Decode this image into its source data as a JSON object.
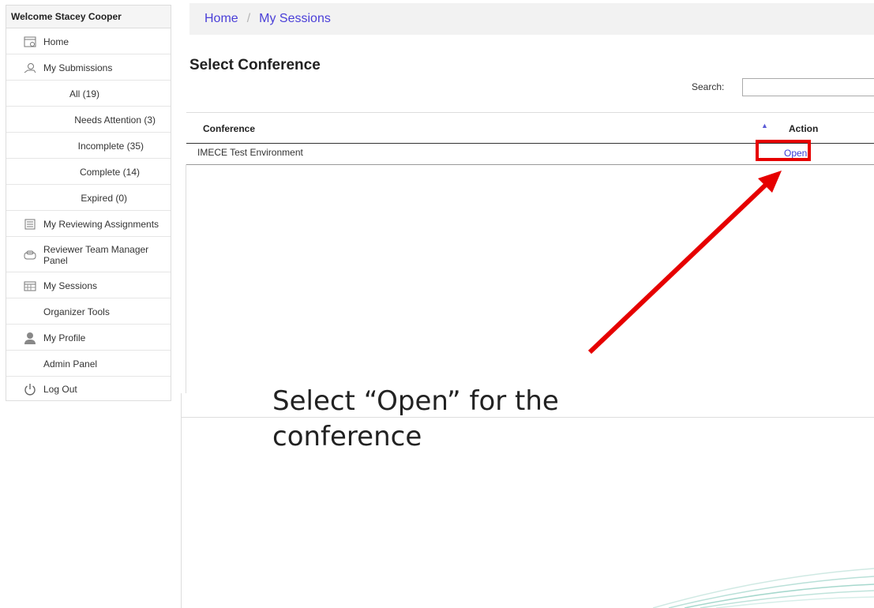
{
  "sidebar": {
    "welcome": "Welcome Stacey Cooper",
    "items": [
      {
        "label": "Home",
        "icon": "home-icon"
      },
      {
        "label": "My Submissions",
        "icon": "submissions-icon"
      },
      {
        "label": "All (19)"
      },
      {
        "label": "Needs Attention (3)"
      },
      {
        "label": "Incomplete (35)"
      },
      {
        "label": "Complete (14)"
      },
      {
        "label": "Expired (0)"
      },
      {
        "label": "My Reviewing Assignments",
        "icon": "reviewing-icon"
      },
      {
        "label": "Reviewer Team Manager Panel",
        "icon": "team-manager-icon"
      },
      {
        "label": "My Sessions",
        "icon": "calendar-icon"
      },
      {
        "label": "Organizer Tools"
      },
      {
        "label": "My Profile",
        "icon": "user-icon"
      },
      {
        "label": "Admin Panel"
      },
      {
        "label": "Log Out",
        "icon": "power-icon"
      }
    ]
  },
  "breadcrumb": {
    "home": "Home",
    "separator": "/",
    "current": "My Sessions"
  },
  "page_title": "Select Conference",
  "search": {
    "label": "Search:",
    "value": ""
  },
  "table": {
    "columns": [
      "Conference",
      "Action"
    ],
    "rows": [
      {
        "conference": "IMECE Test Environment",
        "action": "Open"
      }
    ]
  },
  "annotation": {
    "text": "Select “Open” for the conference",
    "color": "#e60000"
  }
}
